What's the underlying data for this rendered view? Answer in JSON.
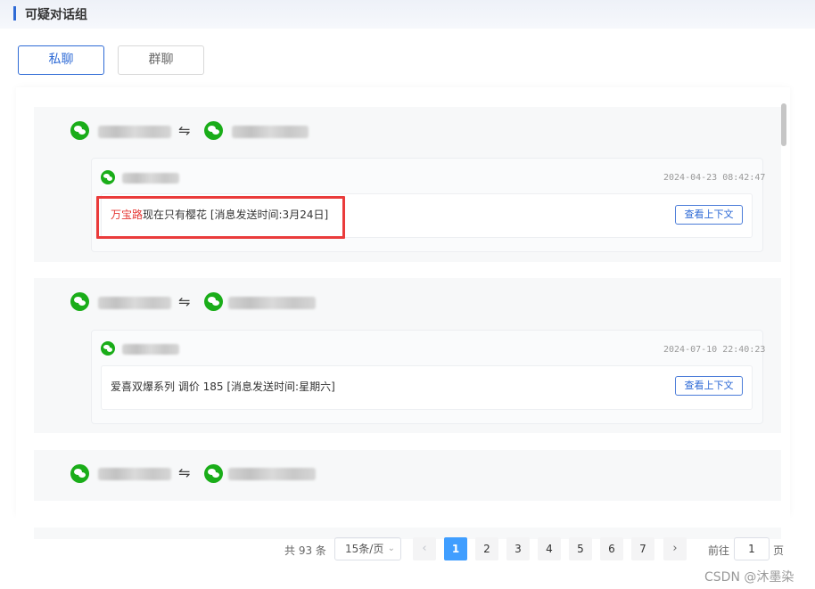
{
  "header": {
    "title": "可疑对话组"
  },
  "tabs": [
    {
      "label": "私聊",
      "active": true
    },
    {
      "label": "群聊",
      "active": false
    }
  ],
  "groups": [
    {
      "swap_glyph": "⇋",
      "message": {
        "timestamp": "2024-04-23 08:42:47",
        "text_highlight": "万宝路",
        "text_rest": "现在只有樱花 [消息发送时间:3月24日]",
        "context_button": "查看上下文",
        "highlighted": true
      }
    },
    {
      "swap_glyph": "⇋",
      "message": {
        "timestamp": "2024-07-10 22:40:23",
        "text": "爱喜双爆系列 调价 185 [消息发送时间:星期六]",
        "context_button": "查看上下文",
        "highlighted": false
      }
    },
    {
      "swap_glyph": "⇋"
    }
  ],
  "pagination": {
    "total_text": "共 93 条",
    "page_size": "15条/页",
    "prev": "‹",
    "next": "›",
    "pages": [
      "1",
      "2",
      "3",
      "4",
      "5",
      "6",
      "7"
    ],
    "current_page": "1",
    "jump_label": "前往",
    "jump_value": "1",
    "jump_unit": "页"
  },
  "watermark": "CSDN @沐墨染",
  "colors": {
    "accent": "#2f6bd6",
    "wechat_green": "#1aad19",
    "highlight_red": "#e53935",
    "page_active": "#409eff"
  }
}
